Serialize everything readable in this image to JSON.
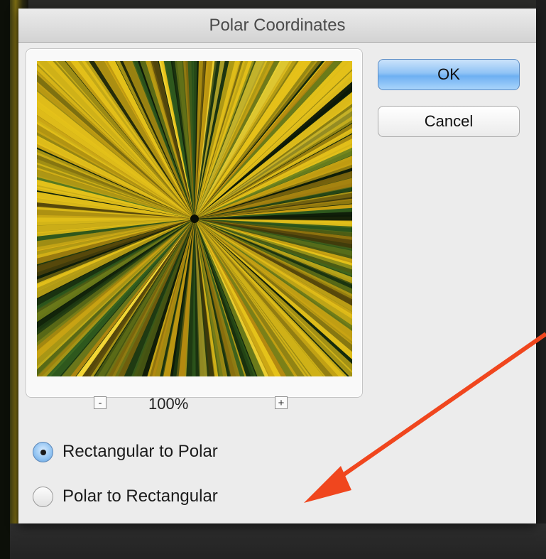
{
  "dialog": {
    "title": "Polar Coordinates"
  },
  "buttons": {
    "ok_label": "OK",
    "cancel_label": "Cancel"
  },
  "preview": {
    "zoom_minus": "-",
    "zoom_level": "100%",
    "zoom_plus": "+"
  },
  "options": {
    "rect_to_polar": "Rectangular to Polar",
    "polar_to_rect": "Polar to Rectangular",
    "selected": "Rectangular to Polar"
  },
  "colors": {
    "ok_accent": "#6eb0f2",
    "annotation_arrow": "#f0461e",
    "preview_yellow": "#e6c21a",
    "preview_green": "#2f5a1e"
  }
}
